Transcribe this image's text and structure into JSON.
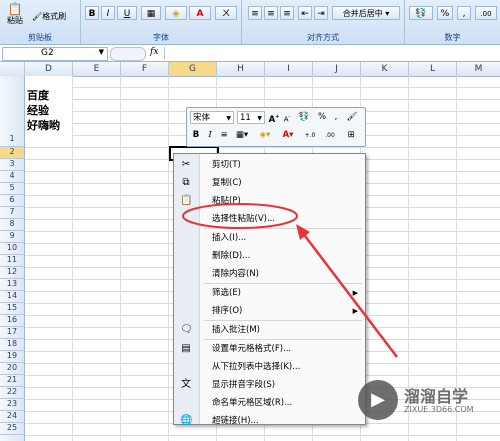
{
  "ribbon": {
    "groups": [
      {
        "label": "剪贴板",
        "buttons": [
          "粘贴",
          "格式刷"
        ]
      },
      {
        "label": "字体"
      },
      {
        "label": "对齐方式",
        "merge": "合并后居中"
      },
      {
        "label": "数字",
        "percent": "%",
        "comma": ","
      }
    ]
  },
  "namebox": "G2",
  "formula_icon": "fx",
  "columns": [
    "D",
    "E",
    "F",
    "G",
    "H",
    "I",
    "J",
    "K",
    "L",
    "M"
  ],
  "rows": [
    "1",
    "2",
    "3",
    "4",
    "5",
    "6",
    "7",
    "8",
    "9",
    "10",
    "11",
    "12",
    "13",
    "14",
    "15",
    "16",
    "17",
    "18",
    "19",
    "20",
    "21",
    "22",
    "23",
    "24",
    "25"
  ],
  "cell_d1": [
    "百度",
    "经验",
    "好嗨哟"
  ],
  "mini": {
    "font": "宋体",
    "size": "11",
    "bold": "B",
    "italic": "I",
    "percent": "%",
    "comma": ","
  },
  "menu": [
    {
      "label": "剪切(T)",
      "icon": "scissors-icon"
    },
    {
      "label": "复制(C)",
      "icon": "copy-icon"
    },
    {
      "label": "粘贴(P)",
      "icon": "paste-icon"
    },
    {
      "label": "选择性粘贴(V)...",
      "icon": ""
    },
    {
      "label": "插入(I)...",
      "icon": ""
    },
    {
      "label": "删除(D)...",
      "icon": ""
    },
    {
      "label": "清除内容(N)",
      "icon": ""
    },
    {
      "label": "筛选(E)",
      "icon": "",
      "submenu": true
    },
    {
      "label": "排序(O)",
      "icon": "",
      "submenu": true
    },
    {
      "label": "插入批注(M)",
      "icon": "comment-icon"
    },
    {
      "label": "设置单元格格式(F)...",
      "icon": "format-icon"
    },
    {
      "label": "从下拉列表中选择(K)...",
      "icon": ""
    },
    {
      "label": "显示拼音字段(S)",
      "icon": "pinyin-icon"
    },
    {
      "label": "命名单元格区域(R)...",
      "icon": ""
    },
    {
      "label": "超链接(H)...",
      "icon": "link-icon"
    }
  ],
  "watermark": {
    "title": "溜溜自学",
    "url": "ZIXUE.3D66.COM"
  },
  "colors": {
    "annotation": "#e8333a"
  }
}
